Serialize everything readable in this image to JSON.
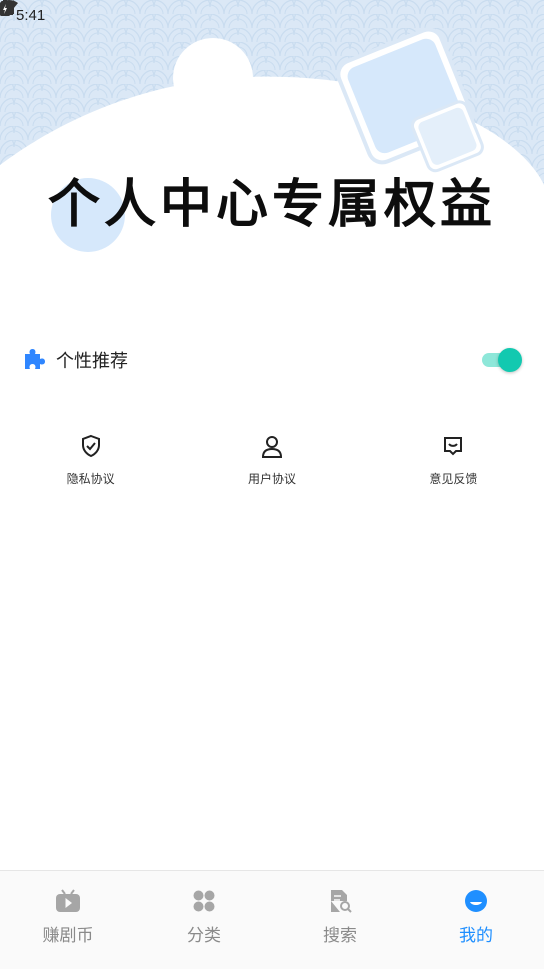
{
  "status_bar": {
    "time": "5:41"
  },
  "hero": {
    "title": "个人中心专属权益"
  },
  "preference": {
    "label": "个性推荐",
    "enabled": true,
    "accent": "#12c9b0"
  },
  "links": [
    {
      "label": "隐私协议",
      "icon": "shield-check-icon"
    },
    {
      "label": "用户协议",
      "icon": "user-icon"
    },
    {
      "label": "意见反馈",
      "icon": "feedback-icon"
    }
  ],
  "bottom_nav": [
    {
      "label": "赚剧币",
      "icon": "tv-play-icon",
      "active": false
    },
    {
      "label": "分类",
      "icon": "grid-icon",
      "active": false
    },
    {
      "label": "搜索",
      "icon": "document-search-icon",
      "active": false
    },
    {
      "label": "我的",
      "icon": "profile-icon",
      "active": true
    }
  ],
  "colors": {
    "active_nav": "#1f8fff",
    "inactive_nav": "#8a8a8a"
  }
}
